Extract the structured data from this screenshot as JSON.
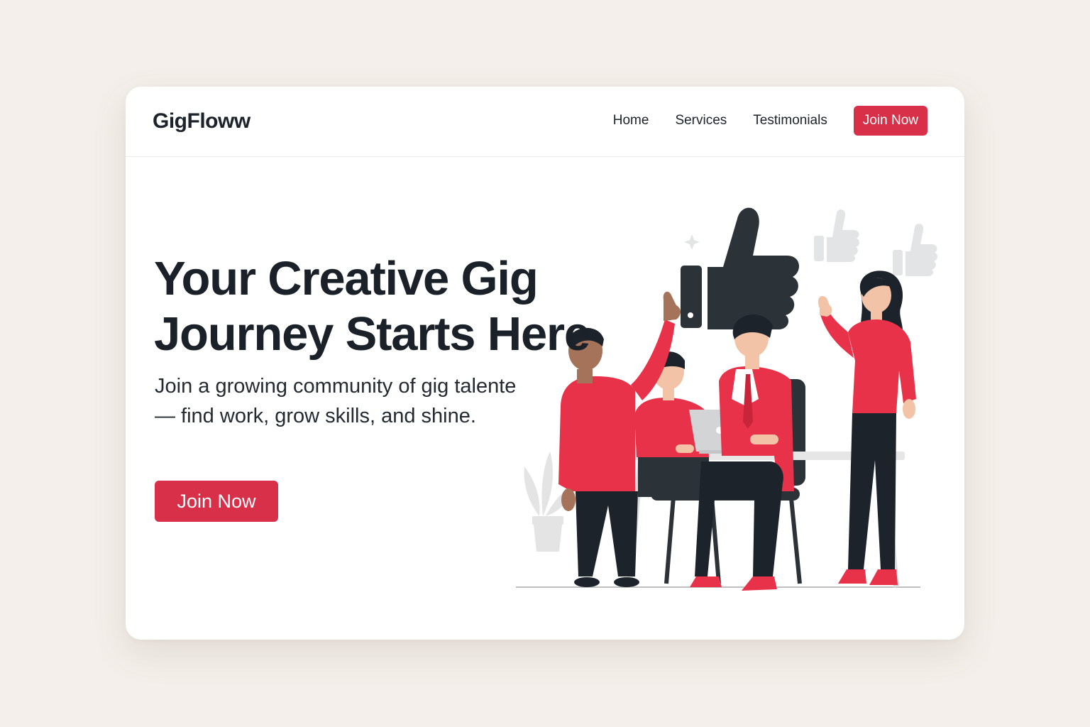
{
  "brand": {
    "name": "GigFloww"
  },
  "nav": {
    "links": [
      {
        "label": "Home"
      },
      {
        "label": "Services"
      },
      {
        "label": "Testimonials"
      }
    ],
    "cta_label": "Join Now"
  },
  "hero": {
    "title": "Your Creative Gig Journey Starts Here",
    "subtitle": "Join a growing community of gig talente — find work, grow skills, and shine.",
    "cta_label": "Join Now"
  },
  "illustration": {
    "icons": [
      "thumbs-up-icon",
      "sparkle-icon",
      "plant-icon",
      "laptop-icon"
    ]
  },
  "colors": {
    "accent": "#d9304a",
    "text": "#1b2128",
    "page_background": "#f4efea",
    "card_background": "#ffffff",
    "dark_icon": "#2b3238",
    "light_icon": "#e7e7e7"
  }
}
